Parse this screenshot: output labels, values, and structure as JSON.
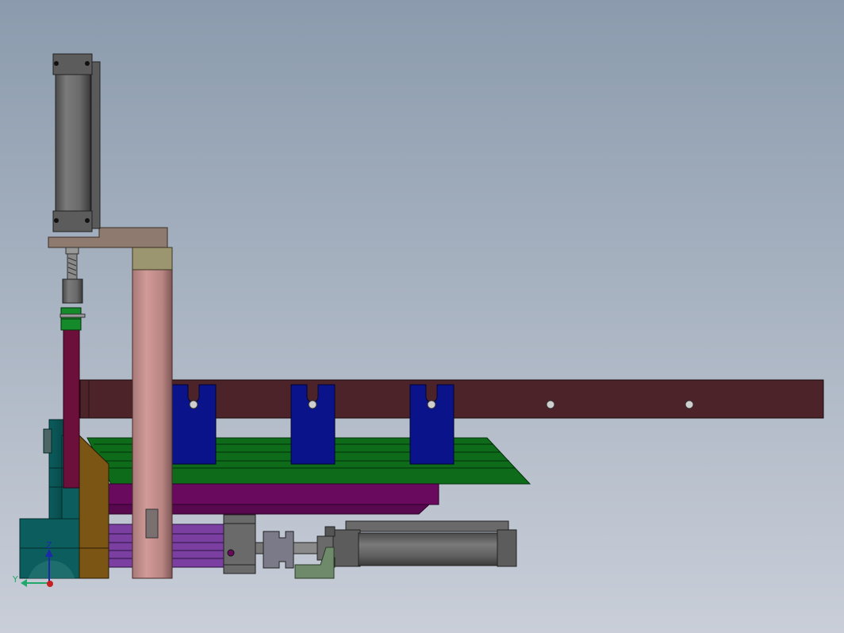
{
  "viewport": {
    "background_top": "#8b9bad",
    "background_bottom": "#c9ced8"
  },
  "triad": {
    "z_label": "Z",
    "y_label": "Y",
    "z_color": "#1c2aa8",
    "y_color": "#23a86c",
    "x_color": "#c81f1f"
  },
  "parts": [
    "vertical-cylinder",
    "cylinder-mount-plate",
    "vertical-column",
    "horizontal-beam",
    "u-clamp-blocks",
    "green-plate",
    "purple-plate",
    "teal-base",
    "brown-triangle-support",
    "horizontal-cylinder",
    "coupling"
  ],
  "colors": {
    "maroon": "#4c2328",
    "blue": "#0a138a",
    "green": "#0d6b1a",
    "purple": "#6a0a5e",
    "teal": "#0b5d5e",
    "brown": "#7b5514",
    "pink": "#c58987",
    "khaki": "#8a8a5a",
    "gray": "#6a6a6a"
  }
}
